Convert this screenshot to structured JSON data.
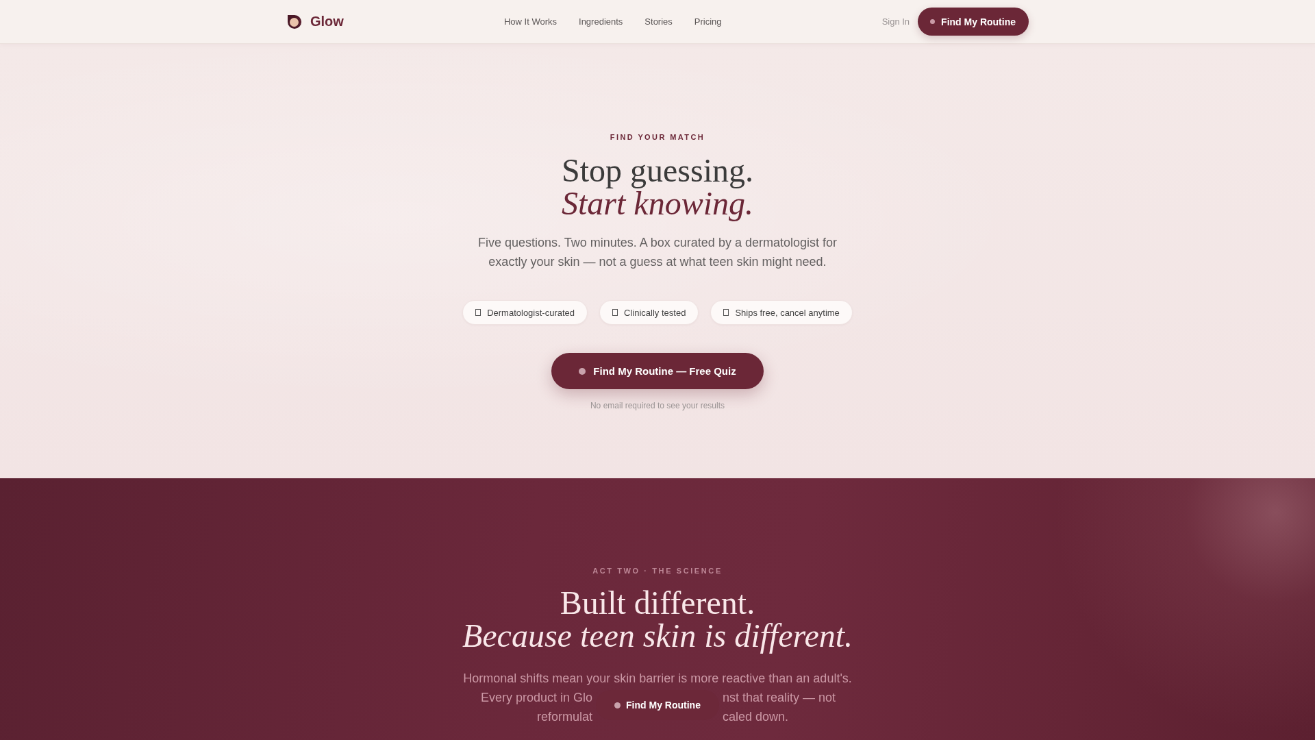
{
  "nav": {
    "brand": "Glow",
    "links": [
      "How It Works",
      "Ingredients",
      "Stories",
      "Pricing"
    ],
    "sign_in": "Sign In",
    "cta": "Find My Routine"
  },
  "hero": {
    "eyebrow": "FIND YOUR MATCH",
    "title": "Stop guessing.",
    "title_italic": "Start knowing.",
    "text": "Five questions. Two minutes. A box curated by a dermatologist for exactly your skin — not a guess at what teen skin might need.",
    "badges": [
      "Dermatologist-curated",
      "Clinically tested",
      "Ships free, cancel anytime"
    ],
    "cta": "Find My Routine — Free Quiz",
    "note": "No email required to see your results"
  },
  "science": {
    "eyebrow": "ACT TWO · THE SCIENCE",
    "title": "Built different.",
    "title_italic": "Because teen skin is different.",
    "body_lines": [
      [
        "Hormonal shifts mean your skin barrier is more reactive than an adult's."
      ],
      [
        "Every product in Glo",
        "nst that reality — not"
      ],
      [
        "reformulat",
        "caled down."
      ]
    ]
  },
  "floating_cta": {
    "label": "Find My Routine"
  }
}
